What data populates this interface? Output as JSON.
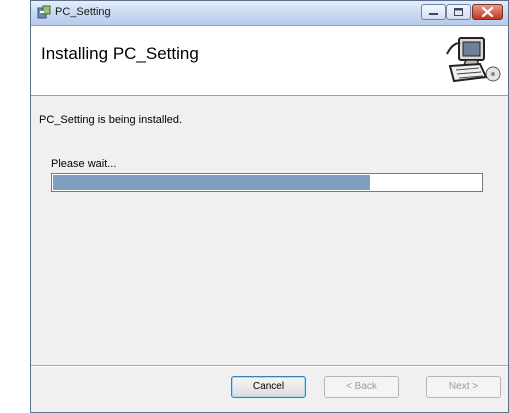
{
  "window": {
    "title": "PC_Setting",
    "header_title": "Installing PC_Setting"
  },
  "content": {
    "status_text": "PC_Setting is being installed.",
    "wait_text": "Please wait...",
    "progress_fraction": 0.74
  },
  "buttons": {
    "cancel_label": "Cancel",
    "back_label": "< Back",
    "next_label": "Next >"
  },
  "icons": {
    "app": "installer-icon",
    "header": "computer-setup-icon",
    "minimize": "minimize-icon",
    "maximize": "maximize-icon",
    "close": "close-icon"
  },
  "colors": {
    "progress_fill": "#7f9fc2",
    "close_button": "#c0361f"
  }
}
